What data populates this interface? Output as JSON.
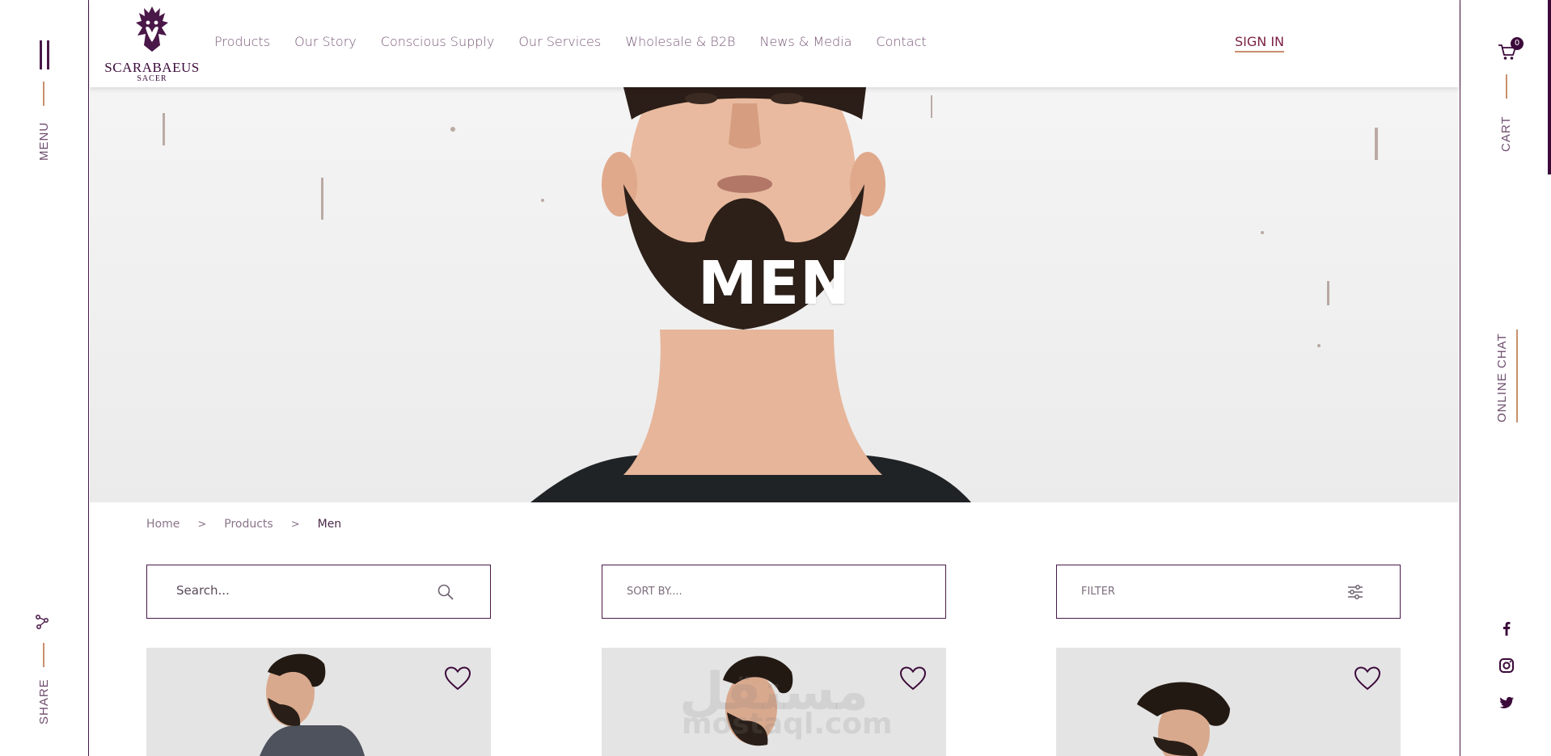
{
  "left_rail": {
    "menu_label": "MENU",
    "share_label": "SHARE"
  },
  "right_rail": {
    "cart_label": "CART",
    "cart_count": "0",
    "online_chat_label": "ONLINE CHAT",
    "social_icons": [
      "facebook-icon",
      "instagram-icon",
      "twitter-icon"
    ]
  },
  "header": {
    "logo_name": "SCARABAEUS",
    "logo_sub": "SACER",
    "nav": [
      {
        "label": "Products"
      },
      {
        "label": "Our Story"
      },
      {
        "label": "Conscious Supply"
      },
      {
        "label": "Our Services"
      },
      {
        "label": "Wholesale & B2B"
      },
      {
        "label": "News & Media"
      },
      {
        "label": "Contact"
      }
    ],
    "sign_in": "SIGN IN"
  },
  "hero": {
    "title": "MEN"
  },
  "breadcrumb": {
    "items": [
      "Home",
      "Products",
      "Men"
    ],
    "separator": ">"
  },
  "controls": {
    "search_placeholder": "Search...",
    "sort_label": "SORT BY....",
    "filter_label": "FILTER"
  },
  "watermark": {
    "arabic": "مستقل",
    "latin": "mostaql.com"
  },
  "colors": {
    "brand": "#3b0a3a",
    "accent": "#c98f6e",
    "nav_text": "#7a5a79",
    "card_bg": "#e4e4e4"
  }
}
